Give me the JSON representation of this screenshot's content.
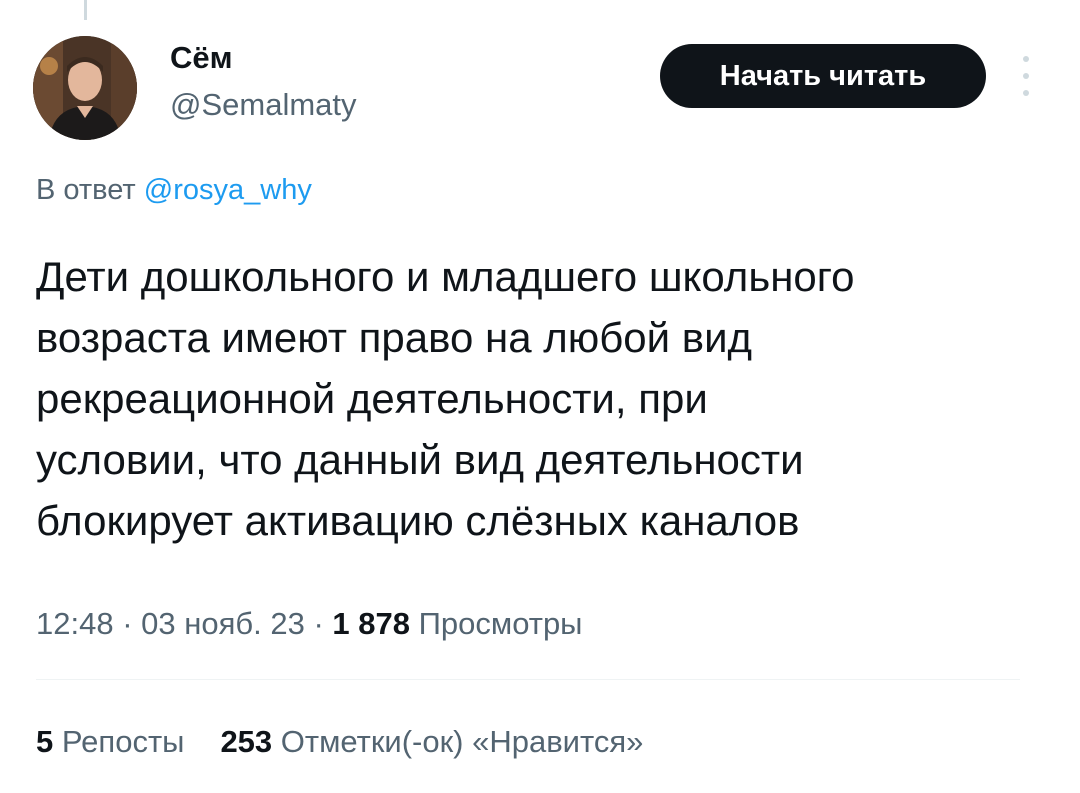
{
  "author": {
    "display_name": "Сём",
    "handle": "@Semalmaty"
  },
  "follow_button": {
    "label": "Начать читать"
  },
  "reply": {
    "prefix": "В ответ ",
    "mention": "@rosya_why"
  },
  "tweet": {
    "text": "Дети дошкольного и младшего школьного\nвозраста имеют право на любой вид\nрекреационной деятельности, при\nусловии, что данный вид деятельности\nблокирует активацию слёзных каналов"
  },
  "meta": {
    "time": "12:48",
    "sep1": " · ",
    "date": "03 нояб. 23",
    "sep2": " · ",
    "views_count": "1 878",
    "views_label": " Просмотры"
  },
  "stats": {
    "reposts_count": "5",
    "reposts_label": " Репосты",
    "likes_count": "253",
    "likes_label": " Отметки(-ок) «Нравится»"
  },
  "colors": {
    "accent": "#1d9bf0",
    "text_primary": "#0f1419",
    "text_secondary": "#536471",
    "button_bg": "#0f1419"
  },
  "icons": {
    "more": "more-vertical-icon",
    "avatar": "avatar-photo"
  }
}
